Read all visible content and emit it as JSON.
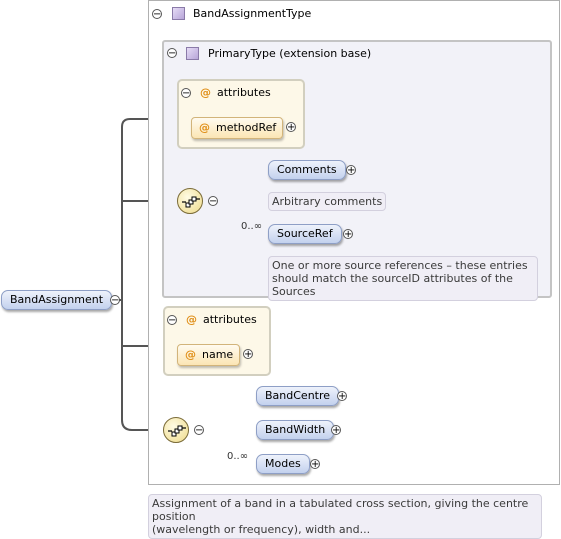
{
  "root": {
    "label": "BandAssignment"
  },
  "type_box": {
    "label": "BandAssignmentType"
  },
  "primary": {
    "label": "PrimaryType (extension base)"
  },
  "attributes_primary": {
    "label": "attributes",
    "items": [
      {
        "label": "methodRef"
      }
    ]
  },
  "sequence_primary": {
    "children": [
      {
        "label": "Comments",
        "cardinality": "",
        "annotation": "Arbitrary comments"
      },
      {
        "label": "SourceRef",
        "cardinality": "0..∞",
        "annotation_line1": "One or more source references – these entries",
        "annotation_line2": "should match the sourceID attributes of the Sources"
      }
    ]
  },
  "attributes_main": {
    "label": "attributes",
    "items": [
      {
        "label": "name"
      }
    ]
  },
  "sequence_main": {
    "children": [
      {
        "label": "BandCentre",
        "cardinality": ""
      },
      {
        "label": "BandWidth",
        "cardinality": ""
      },
      {
        "label": "Modes",
        "cardinality": "0..∞"
      }
    ]
  },
  "root_annotation": {
    "line1": "Assignment of a band in a tabulated cross section, giving the centre position",
    "line2": "(wavelength or frequency), width and..."
  },
  "colors": {
    "element": "#c3d1ee",
    "attribute": "#fbe5b4",
    "annotation": "#f0eef6",
    "connector": "#555555"
  }
}
